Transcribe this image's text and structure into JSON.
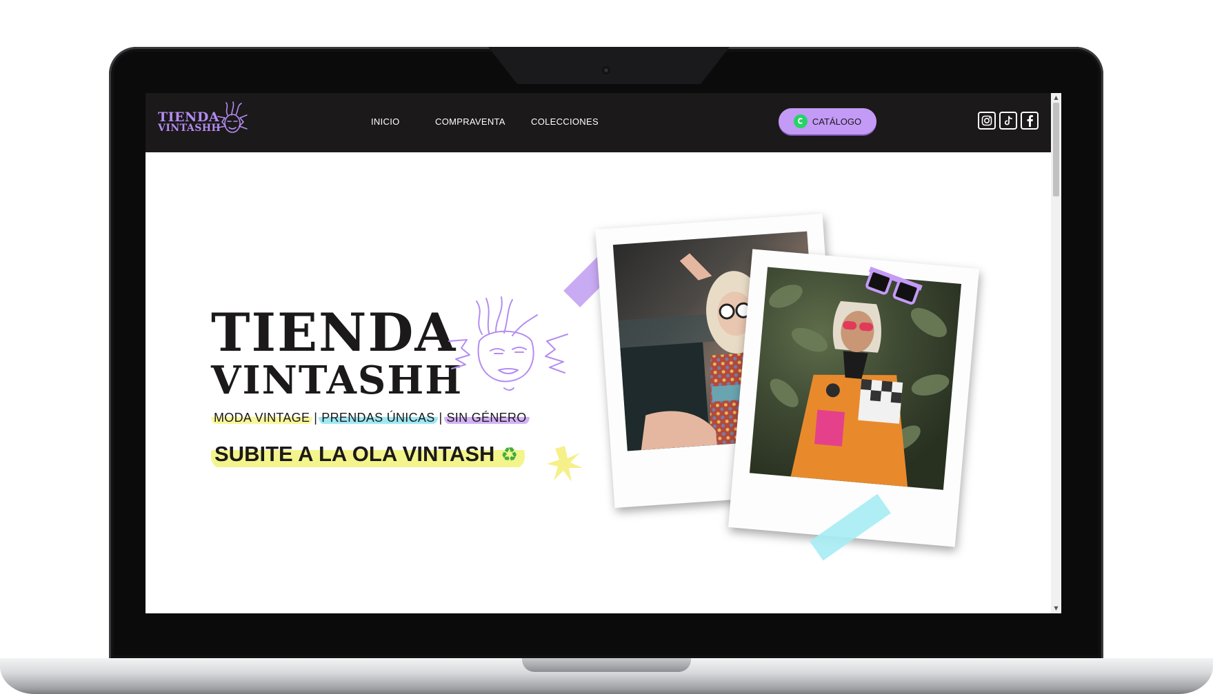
{
  "header": {
    "logo_line1": "TIENDA",
    "logo_line2": "VINTASHH",
    "nav": [
      {
        "label": "INICIO"
      },
      {
        "label": "COMPRAVENTA"
      },
      {
        "label": "COLECCIONES"
      }
    ],
    "catalog_button": {
      "label": "CATÁLOGO",
      "icon": "whatsapp-icon"
    },
    "social": [
      {
        "icon": "instagram-icon"
      },
      {
        "icon": "tiktok-icon"
      },
      {
        "icon": "facebook-icon"
      }
    ]
  },
  "hero": {
    "title_line1": "TIENDA",
    "title_line2": "VINTASHH",
    "tags": [
      "MODA VINTAGE",
      "PRENDAS ÚNICAS",
      "SIN GÉNERO"
    ],
    "separator": "|",
    "slogan": "SUBITE A LA OLA VINTASH",
    "slogan_icon": "♻"
  },
  "colors": {
    "accent_purple": "#c49af7",
    "header_bg": "#1b1919",
    "highlight_yellow": "#f3f48c",
    "highlight_cyan": "#9de8f2",
    "highlight_purple": "#d2b1f6"
  }
}
